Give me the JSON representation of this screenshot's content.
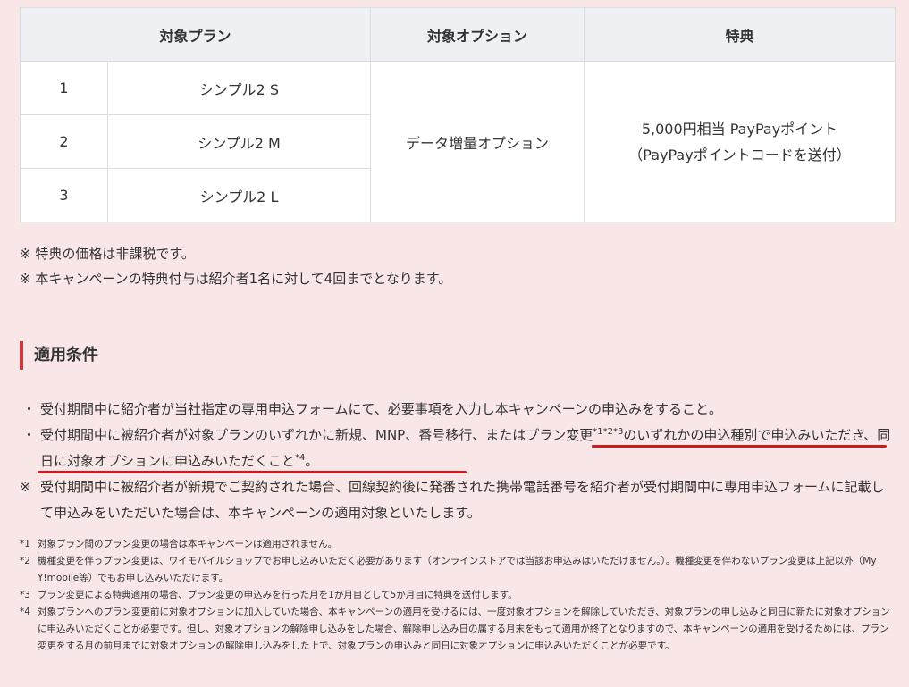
{
  "table": {
    "headers": [
      "対象プラン",
      "対象オプション",
      "特典"
    ],
    "rows": [
      {
        "no": "1",
        "plan": "シンプル2 S"
      },
      {
        "no": "2",
        "plan": "シンプル2 M"
      },
      {
        "no": "3",
        "plan": "シンプル2 L"
      }
    ],
    "option": "データ増量オプション",
    "benefit_line1": "5,000円相当 PayPayポイント",
    "benefit_line2": "（PayPayポイントコードを送付）"
  },
  "notes": [
    "※ 特典の価格は非課税です。",
    "※ 本キャンペーンの特典付与は紹介者1名に対して4回までとなります。"
  ],
  "section_title": "適用条件",
  "conditions": {
    "bullet": "・",
    "note_mark": "※",
    "item1": "受付期間中に紹介者が当社指定の専用申込フォームにて、必要事項を入力し本キャンペーンの申込みをすること。",
    "item2_pre": "受付期間中に被紹介者が対象プランのいずれかに新規、MNP、番号移行、または",
    "item2_u1": "プラン変更",
    "item2_sup1": "*1*2*3",
    "item2_u2": "のいずれかの申込種別で申込みいただき、同日に対象オプションに申込みいただくこと",
    "item2_sup2": "*4",
    "item2_post": "。",
    "item3": "受付期間中に被紹介者が新規でご契約された場合、回線契約後に発番された携帯電話番号を紹介者が受付期間中に専用申込フォームに記載して申込みをいただいた場合は、本キャンペーンの適用対象といたします。",
    "underline_color": "#d0181f"
  },
  "footnotes": [
    {
      "mark": "*1",
      "text": "対象プラン間のプラン変更の場合は本キャンペーンは適用されません。"
    },
    {
      "mark": "*2",
      "text": "機種変更を伴うプラン変更は、ワイモバイルショップでお申し込みいただく必要があります（オンラインストアでは当該お申込みはいただけません。）。機種変更を伴わないプラン変更は上記以外（My Y!mobile等）でもお申し込みいただけます。"
    },
    {
      "mark": "*3",
      "text": "プラン変更による特典適用の場合、プラン変更の申込みを行った月を1か月目として5か月目に特典を送付します。"
    },
    {
      "mark": "*4",
      "text": "対象プランへのプラン変更前に対象オプションに加入していた場合、本キャンペーンの適用を受けるには、一度対象オプションを解除していただき、対象プランの申し込みと同日に新たに対象オプションに申込みいただくことが必要です。但し、対象オプションの解除申し込みをした場合、解除申し込み日の属する月末をもって適用が終了となりますので、本キャンペーンの適用を受けるためには、プラン変更をする月の前月までに対象オプションの解除申し込みをした上で、対象プランの申込みと同日に対象オプションに申込みいただくことが必要です。"
    }
  ],
  "colors": {
    "accent": "#d2363c",
    "background": "#f8e7e6",
    "header_bg": "#eef0f4"
  }
}
